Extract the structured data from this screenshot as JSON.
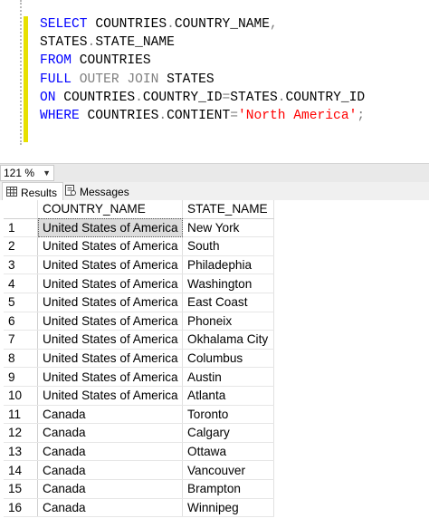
{
  "editor": {
    "lines": [
      [
        {
          "t": "SELECT ",
          "c": "kw"
        },
        {
          "t": "COUNTRIES",
          "c": ""
        },
        {
          "t": ".",
          "c": "gray"
        },
        {
          "t": "COUNTRY_NAME",
          "c": ""
        },
        {
          "t": ",",
          "c": "gray"
        }
      ],
      [
        {
          "t": "STATES",
          "c": ""
        },
        {
          "t": ".",
          "c": "gray"
        },
        {
          "t": "STATE_NAME",
          "c": ""
        }
      ],
      [
        {
          "t": "FROM ",
          "c": "kw"
        },
        {
          "t": "COUNTRIES",
          "c": ""
        }
      ],
      [
        {
          "t": "FULL ",
          "c": "kw"
        },
        {
          "t": "OUTER JOIN ",
          "c": "gray"
        },
        {
          "t": "STATES",
          "c": ""
        }
      ],
      [
        {
          "t": "ON ",
          "c": "kw"
        },
        {
          "t": "COUNTRIES",
          "c": ""
        },
        {
          "t": ".",
          "c": "gray"
        },
        {
          "t": "COUNTRY_ID",
          "c": ""
        },
        {
          "t": "=",
          "c": "gray"
        },
        {
          "t": "STATES",
          "c": ""
        },
        {
          "t": ".",
          "c": "gray"
        },
        {
          "t": "COUNTRY_ID",
          "c": ""
        }
      ],
      [
        {
          "t": "WHERE ",
          "c": "kw"
        },
        {
          "t": "COUNTRIES",
          "c": ""
        },
        {
          "t": ".",
          "c": "gray"
        },
        {
          "t": "CONTIENT",
          "c": ""
        },
        {
          "t": "=",
          "c": "gray"
        },
        {
          "t": "'North America'",
          "c": "str"
        },
        {
          "t": ";",
          "c": "gray"
        }
      ]
    ]
  },
  "zoom": {
    "value": "121 %"
  },
  "tabs": {
    "results": "Results",
    "messages": "Messages"
  },
  "grid": {
    "columns": [
      "COUNTRY_NAME",
      "STATE_NAME"
    ],
    "rows": [
      [
        "1",
        "United States of America",
        "New York"
      ],
      [
        "2",
        "United States of America",
        "South"
      ],
      [
        "3",
        "United States of America",
        "Philadephia"
      ],
      [
        "4",
        "United States of America",
        "Washington"
      ],
      [
        "5",
        "United States of America",
        "East Coast"
      ],
      [
        "6",
        "United States of America",
        "Phoneix"
      ],
      [
        "7",
        "United States of America",
        "Okhalama City"
      ],
      [
        "8",
        "United States of America",
        "Columbus"
      ],
      [
        "9",
        "United States of America",
        "Austin"
      ],
      [
        "10",
        "United States of America",
        "Atlanta"
      ],
      [
        "11",
        "Canada",
        "Toronto"
      ],
      [
        "12",
        "Canada",
        "Calgary"
      ],
      [
        "13",
        "Canada",
        "Ottawa"
      ],
      [
        "14",
        "Canada",
        "Vancouver"
      ],
      [
        "15",
        "Canada",
        "Brampton"
      ],
      [
        "16",
        "Canada",
        "Winnipeg"
      ]
    ]
  }
}
